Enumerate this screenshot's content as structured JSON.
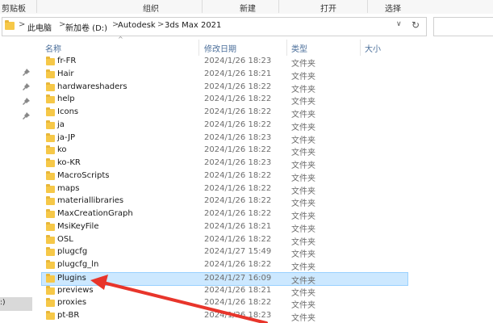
{
  "ribbon": {
    "clipboard": "剪贴板",
    "organize": "组织",
    "new": "新建",
    "open": "打开",
    "select": "选择"
  },
  "address": {
    "crumbs": [
      "此电脑",
      "新加卷 (D:)",
      "Autodesk",
      "3ds Max 2021"
    ],
    "separator": ">",
    "dropdown_glyph": "∨",
    "refresh_glyph": "↻"
  },
  "nav": {
    "drive_label": ":)"
  },
  "columns": {
    "name": "名称",
    "date": "修改日期",
    "type": "类型",
    "size": "大小"
  },
  "files": [
    {
      "name": "fr-FR",
      "date": "2024/1/26 18:23",
      "type": "文件夹"
    },
    {
      "name": "Hair",
      "date": "2024/1/26 18:21",
      "type": "文件夹"
    },
    {
      "name": "hardwareshaders",
      "date": "2024/1/26 18:22",
      "type": "文件夹"
    },
    {
      "name": "help",
      "date": "2024/1/26 18:22",
      "type": "文件夹"
    },
    {
      "name": "Icons",
      "date": "2024/1/26 18:22",
      "type": "文件夹"
    },
    {
      "name": "ja",
      "date": "2024/1/26 18:22",
      "type": "文件夹"
    },
    {
      "name": "ja-JP",
      "date": "2024/1/26 18:23",
      "type": "文件夹"
    },
    {
      "name": "ko",
      "date": "2024/1/26 18:22",
      "type": "文件夹"
    },
    {
      "name": "ko-KR",
      "date": "2024/1/26 18:23",
      "type": "文件夹"
    },
    {
      "name": "MacroScripts",
      "date": "2024/1/26 18:22",
      "type": "文件夹"
    },
    {
      "name": "maps",
      "date": "2024/1/26 18:22",
      "type": "文件夹"
    },
    {
      "name": "materiallibraries",
      "date": "2024/1/26 18:22",
      "type": "文件夹"
    },
    {
      "name": "MaxCreationGraph",
      "date": "2024/1/26 18:22",
      "type": "文件夹"
    },
    {
      "name": "MsiKeyFile",
      "date": "2024/1/26 18:21",
      "type": "文件夹"
    },
    {
      "name": "OSL",
      "date": "2024/1/26 18:22",
      "type": "文件夹"
    },
    {
      "name": "plugcfg",
      "date": "2024/1/27 15:49",
      "type": "文件夹"
    },
    {
      "name": "plugcfg_ln",
      "date": "2024/1/26 18:22",
      "type": "文件夹"
    },
    {
      "name": "Plugins",
      "date": "2024/1/27 16:09",
      "type": "文件夹",
      "selected": true
    },
    {
      "name": "previews",
      "date": "2024/1/26 18:21",
      "type": "文件夹"
    },
    {
      "name": "proxies",
      "date": "2024/1/26 18:22",
      "type": "文件夹"
    },
    {
      "name": "pt-BR",
      "date": "2024/1/26 18:23",
      "type": "文件夹"
    }
  ],
  "colors": {
    "selection_bg": "#cce8ff",
    "selection_border": "#99d1ff",
    "folder": "#f6c848",
    "annotation_arrow": "#e8352b"
  }
}
